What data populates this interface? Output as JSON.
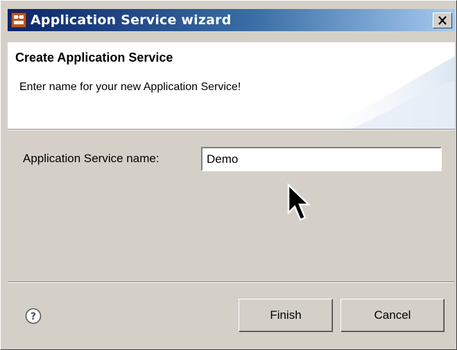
{
  "window": {
    "title": "Application Service wizard",
    "close_glyph": "✕"
  },
  "banner": {
    "title": "Create Application Service",
    "message": "Enter name for your new Application Service!"
  },
  "form": {
    "name_label": "Application Service name:",
    "name_value": "Demo"
  },
  "footer": {
    "help_icon": "question-mark-icon",
    "finish_label": "Finish",
    "cancel_label": "Cancel"
  },
  "colors": {
    "title_bar_start": "#0a246a",
    "title_bar_end": "#a6caf0",
    "dialog_bg": "#d4d0c8",
    "banner_bg": "#ffffff"
  }
}
